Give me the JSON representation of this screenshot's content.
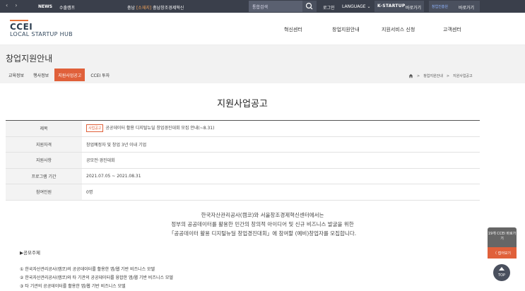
{
  "topbar": {
    "prev_arrow": "‹",
    "next_arrow": "›",
    "news": "NEWS",
    "camp": "수출캠프",
    "region_prefix": "충남",
    "region_tag": "[소재지]",
    "region_name": "충남창조경제혁신",
    "search_placeholder": "통합검색",
    "login": "로그인",
    "language": "LANGUAGE ⌄",
    "kstartup_logo": "K-STARTUP",
    "kstartup_go": "바로가기",
    "partner_logo": "창업진흥원",
    "partner_go": "바로가기"
  },
  "header": {
    "logo_main": "CCEI",
    "logo_sub": "LOCAL STARTUP HUB",
    "nav": [
      "혁신센터",
      "창업지원안내",
      "지원서비스 신청",
      "고객센터"
    ]
  },
  "subvisual": {
    "title": "창업지원안내",
    "tabs": [
      "교육정보",
      "행사정보",
      "지원사업공고",
      "CCEI 투자"
    ],
    "active_tab_index": 2,
    "breadcrumb": [
      "창업지원안내",
      "지원사업공고"
    ]
  },
  "article": {
    "page_title": "지원사업공고",
    "rows": [
      {
        "label": "제목",
        "badge": "사업공고",
        "value": "공공데이터 활용 디지털뉴딜 창업경진대회 모집 안내(~8.31)"
      },
      {
        "label": "지원자격",
        "value": "창업예정자 및 창업 3년 이내 기업"
      },
      {
        "label": "지원사항",
        "value": "공모전·경진대회"
      },
      {
        "label": "프로그램 기간",
        "value": "2021.07.05 ~ 2021.08.31"
      },
      {
        "label": "참여인원",
        "value": "0명"
      }
    ],
    "intro_lines": [
      "한국자산관리공사(캠코)와 서울창조경제혁신센터에서는",
      "정부의 공공데이터를 활용한 민간의 창의적 아이디어 및 신규 비즈니스 발굴을 위한",
      "「공공데이터 활용 디지털뉴딜 창업경진대회」에 참여할 (예비)창업자를 모집합니다."
    ],
    "theme_heading": "▶공모주제",
    "theme_items": [
      "① 한국자산관리공사(캠코)의 공공데이터를 활용한 앱/웹 기반 비즈니스 모델",
      "② 한국자산관리공사(캠코)와 타 기관의 공공데이터를 융합한 앱/웹 기반 비즈니스 모델",
      "③ 타 기관의 공공데이터를 활용한 앱/웹 기반 비즈니스 모델"
    ]
  },
  "floating": {
    "ccei_shortcut": "19개 CCEI 바로가기",
    "collapse": "〈 접어보기",
    "top": "TOP"
  }
}
